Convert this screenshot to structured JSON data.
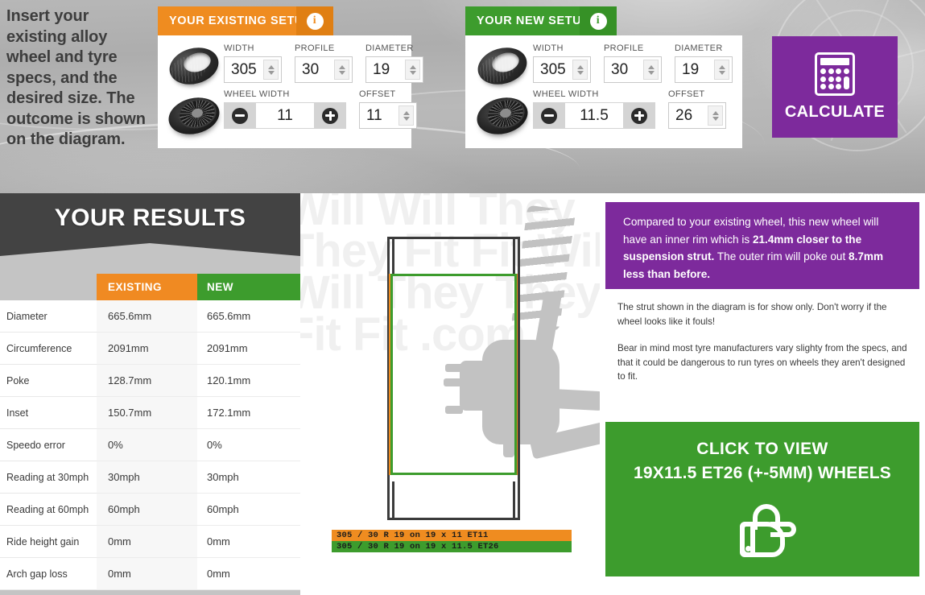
{
  "intro": {
    "text": "Insert your existing alloy wheel and tyre specs, and the desired size. The outcome is shown on the diagram."
  },
  "existing_setup": {
    "title": "YOUR EXISTING SETUP",
    "info_icon": "i",
    "labels": {
      "width": "WIDTH",
      "profile": "PROFILE",
      "diameter": "DIAMETER",
      "wheel_width": "WHEEL WIDTH",
      "offset": "OFFSET"
    },
    "values": {
      "width": "305",
      "profile": "30",
      "diameter": "19",
      "wheel_width": "11",
      "offset": "11"
    }
  },
  "new_setup": {
    "title": "YOUR NEW SETUP",
    "info_icon": "i",
    "labels": {
      "width": "WIDTH",
      "profile": "PROFILE",
      "diameter": "DIAMETER",
      "wheel_width": "WHEEL WIDTH",
      "offset": "OFFSET"
    },
    "values": {
      "width": "305",
      "profile": "30",
      "diameter": "19",
      "wheel_width": "11.5",
      "offset": "26"
    }
  },
  "calculate": {
    "label": "CALCULATE"
  },
  "results": {
    "title": "YOUR RESULTS",
    "columns": [
      "",
      "EXISTING",
      "NEW"
    ],
    "rows": [
      {
        "label": "Diameter",
        "existing": "665.6mm",
        "new": "665.6mm"
      },
      {
        "label": "Circumference",
        "existing": "2091mm",
        "new": "2091mm"
      },
      {
        "label": "Poke",
        "existing": "128.7mm",
        "new": "120.1mm"
      },
      {
        "label": "Inset",
        "existing": "150.7mm",
        "new": "172.1mm"
      },
      {
        "label": "Speedo error",
        "existing": "0%",
        "new": "0%"
      },
      {
        "label": "Reading at 30mph",
        "existing": "30mph",
        "new": "30mph"
      },
      {
        "label": "Reading at 60mph",
        "existing": "60mph",
        "new": "60mph"
      },
      {
        "label": "Ride height gain",
        "existing": "0mm",
        "new": "0mm"
      },
      {
        "label": "Arch gap loss",
        "existing": "0mm",
        "new": "0mm"
      }
    ]
  },
  "diagram": {
    "watermark": "Will Will They They Fit Fit Will Will They They Fit Fit .com",
    "legend_existing": "305 / 30 R 19 on 19 x 11 ET11",
    "legend_new": "305 / 30 R 19 on 19 x 11.5 ET26"
  },
  "callout": {
    "part1": "Compared to your existing wheel, this new wheel will have an inner rim which is ",
    "bold1": "21.4mm closer to the suspension strut.",
    "part2": " The outer rim will poke out ",
    "bold2": "8.7mm less than before."
  },
  "notes": {
    "note1": "The strut shown in the diagram is for show only. Don't worry if the wheel looks like it fouls!",
    "note2": "Bear in mind most tyre manufacturers vary slighty from the specs, and that it could be dangerous to run tyres on wheels they aren't designed to fit."
  },
  "cta": {
    "line1": "CLICK TO VIEW",
    "line2": "19X11.5 ET26 (+-5MM) WHEELS"
  },
  "colors": {
    "orange": "#ef8c20",
    "green": "#3d9c2d",
    "purple": "#7d2a9c",
    "dark": "#434343"
  }
}
